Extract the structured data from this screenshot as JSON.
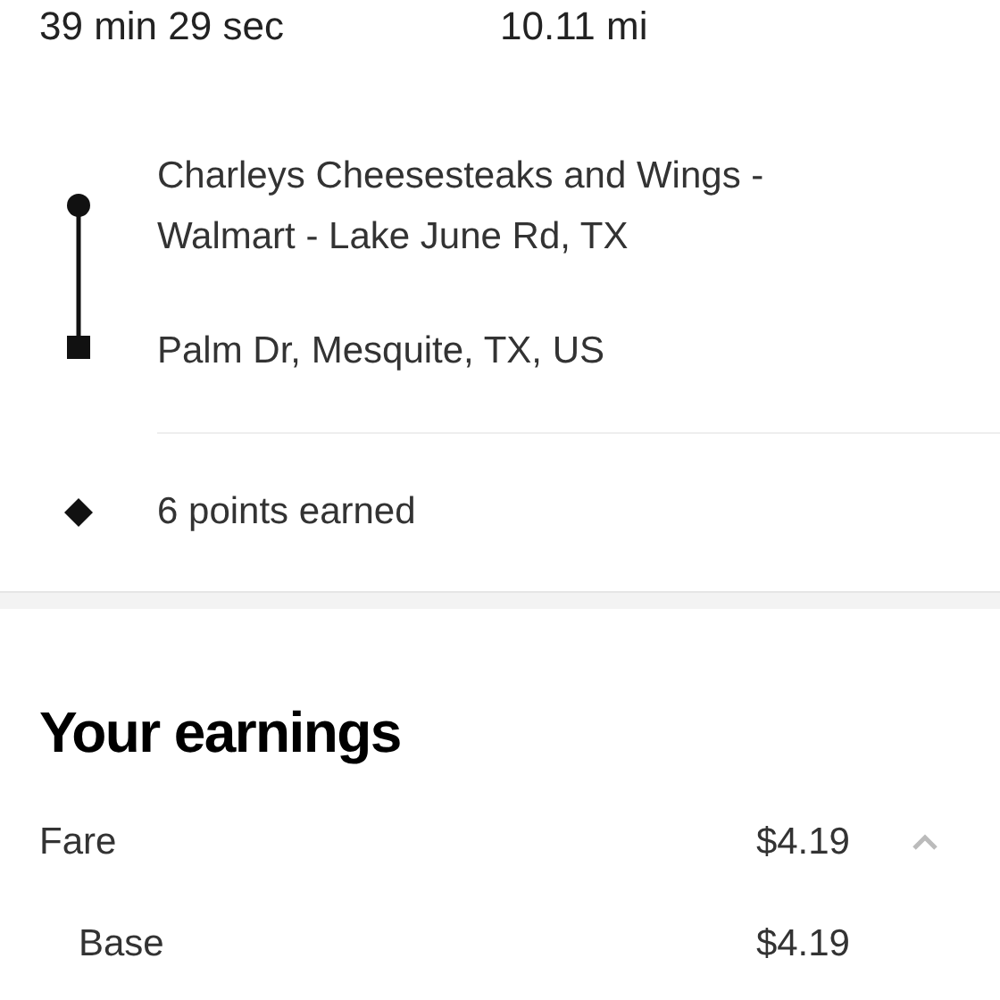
{
  "trip_stats": {
    "duration": "39 min 29 sec",
    "distance": "10.11 mi"
  },
  "route": {
    "pickup": "Charleys Cheesesteaks and Wings - Walmart - Lake June Rd, TX",
    "dropoff": "Palm Dr, Mesquite, TX, US"
  },
  "points": {
    "label": "6 points earned"
  },
  "earnings": {
    "title": "Your earnings",
    "rows": [
      {
        "label": "Fare",
        "amount": "$4.19",
        "expanded": true,
        "children": [
          {
            "label": "Base",
            "amount": "$4.19"
          }
        ]
      }
    ]
  }
}
